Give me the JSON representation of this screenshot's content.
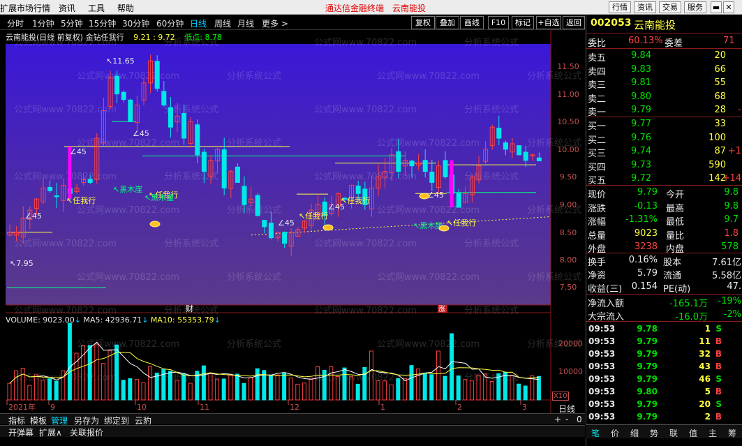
{
  "menu": {
    "items": [
      "扩展市场行情",
      "资讯",
      "工具",
      "帮助"
    ],
    "center_title": "通达信金融终端",
    "center_stock": "云南能投",
    "right_buttons": [
      "行情",
      "资讯",
      "交易",
      "服务"
    ]
  },
  "toolbar": {
    "periods": [
      "分时",
      "1分钟",
      "5分钟",
      "15分钟",
      "30分钟",
      "60分钟",
      "日线",
      "周线",
      "月线",
      "更多 >"
    ],
    "active_period": "日线",
    "buttons": [
      "复权",
      "叠加",
      "画线",
      "F10",
      "标记",
      "+自选",
      "返回"
    ]
  },
  "chart": {
    "title": "云南能投(日线 前复权) 金钻任我行",
    "value1": "9.21",
    "value2": "9.72",
    "low_label": "低点: 8.78",
    "y_labels": [
      "11.50",
      "11.00",
      "10.50",
      "10.00",
      "9.50",
      "9.00",
      "8.50",
      "8.00",
      "7.50"
    ],
    "annotations": {
      "high": "11.65",
      "low": "7.95",
      "a45_1": "45",
      "a45_2": "45",
      "a45_3": "45",
      "a45_4": "45",
      "a45_5": "45",
      "a45_6": "45",
      "rwx1": "任我行",
      "rwx2": "任我行",
      "rwx3": "任我行",
      "rwx4": "任我行",
      "rwx5": "任我行",
      "hmy1": "黑木崖",
      "hmy2": "黑木崖",
      "hmy3": "黑木崖"
    },
    "markers": {
      "cai": "财",
      "zhang": "涨"
    },
    "watermark": "公式网www.70822.com",
    "watermark2": "分析系统公式"
  },
  "volume": {
    "label": "VOLUME: 9023.00",
    "ma5": "MA5: 42936.71",
    "ma10": "MA10: 55353.79",
    "y_labels": [
      "20000",
      "10000"
    ],
    "x10": "X10",
    "x_labels": [
      "2021年",
      "9",
      "10",
      "11",
      "12",
      "1",
      "2",
      "3"
    ]
  },
  "bottom_tabs1": [
    "指标",
    "模板",
    "管理",
    "另存为",
    "绑定到",
    "云豹"
  ],
  "bottom_tabs1_active": "管理",
  "bottom_tabs2": [
    "开弹幕",
    "扩展∧",
    "关联报价"
  ],
  "period_label": "日线",
  "zoom_controls": [
    "+",
    "-",
    "0"
  ],
  "quote": {
    "code": "002053",
    "name": "云南能投",
    "weibi_label": "委比",
    "weibi": "60.13%",
    "weicha_label": "委差",
    "weicha": "71",
    "asks": [
      {
        "label": "卖五",
        "price": "9.84",
        "vol": "20",
        "chg": ""
      },
      {
        "label": "卖四",
        "price": "9.83",
        "vol": "66",
        "chg": ""
      },
      {
        "label": "卖三",
        "price": "9.81",
        "vol": "55",
        "chg": ""
      },
      {
        "label": "卖二",
        "price": "9.80",
        "vol": "68",
        "chg": ""
      },
      {
        "label": "卖一",
        "price": "9.79",
        "vol": "28",
        "chg": "-"
      }
    ],
    "bids": [
      {
        "label": "买一",
        "price": "9.77",
        "vol": "33",
        "chg": ""
      },
      {
        "label": "买二",
        "price": "9.76",
        "vol": "100",
        "chg": ""
      },
      {
        "label": "买三",
        "price": "9.74",
        "vol": "87",
        "chg": "+1"
      },
      {
        "label": "买四",
        "price": "9.73",
        "vol": "590",
        "chg": ""
      },
      {
        "label": "买五",
        "price": "9.72",
        "vol": "142",
        "chg": "+14"
      }
    ],
    "stats": [
      {
        "l1": "现价",
        "v1": "9.79",
        "c1": "g",
        "l2": "今开",
        "v2": "9.8",
        "c2": "g"
      },
      {
        "l1": "涨跌",
        "v1": "-0.13",
        "c1": "g",
        "l2": "最高",
        "v2": "9.8",
        "c2": "g"
      },
      {
        "l1": "涨幅",
        "v1": "-1.31%",
        "c1": "g",
        "l2": "最低",
        "v2": "9.7",
        "c2": "g"
      },
      {
        "l1": "总量",
        "v1": "9023",
        "c1": "y",
        "l2": "量比",
        "v2": "1.8",
        "c2": "r"
      },
      {
        "l1": "外盘",
        "v1": "3238",
        "c1": "r",
        "l2": "内盘",
        "v2": "578",
        "c2": "g"
      }
    ],
    "stats2": [
      {
        "l1": "换手",
        "v1": "0.16%",
        "l2": "股本",
        "v2": "7.61亿"
      },
      {
        "l1": "净资",
        "v1": "5.79",
        "l2": "流通",
        "v2": "5.58亿"
      },
      {
        "l1": "收益(三)",
        "v1": "0.154",
        "l2": "PE(动)",
        "v2": "47."
      }
    ],
    "flow": [
      {
        "label": "净流入额",
        "v1": "-165.1万",
        "v2": "-19%"
      },
      {
        "label": "大宗流入",
        "v1": "-16.0万",
        "v2": "-2%"
      }
    ],
    "ticks": [
      {
        "time": "09:53",
        "price": "9.78",
        "vol": "1",
        "side": "S"
      },
      {
        "time": "09:53",
        "price": "9.79",
        "vol": "11",
        "side": "B"
      },
      {
        "time": "09:53",
        "price": "9.79",
        "vol": "32",
        "side": "B"
      },
      {
        "time": "09:53",
        "price": "9.79",
        "vol": "43",
        "side": "B"
      },
      {
        "time": "09:53",
        "price": "9.79",
        "vol": "46",
        "side": "S"
      },
      {
        "time": "09:53",
        "price": "9.80",
        "vol": "5",
        "side": "B"
      },
      {
        "time": "09:53",
        "price": "9.79",
        "vol": "20",
        "side": "S"
      },
      {
        "time": "09:53",
        "price": "9.79",
        "vol": "2",
        "side": "B"
      }
    ],
    "tabs": [
      "笔",
      "价",
      "细",
      "势",
      "联",
      "值",
      "主",
      "筹"
    ]
  },
  "colors": {
    "up": "#ff4040",
    "down": "#00e8e8",
    "accent": "#00c8ff",
    "magenta": "#ff00ff"
  }
}
